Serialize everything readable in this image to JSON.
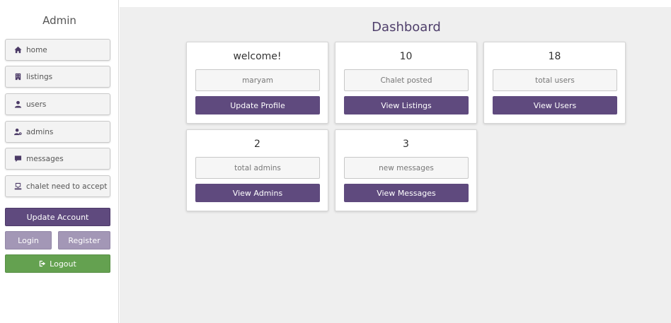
{
  "sidebar": {
    "title": "Admin",
    "items": [
      {
        "label": "home",
        "icon": "home-icon"
      },
      {
        "label": "listings",
        "icon": "building-icon"
      },
      {
        "label": "users",
        "icon": "user-icon"
      },
      {
        "label": "admins",
        "icon": "user-gear-icon"
      },
      {
        "label": "messages",
        "icon": "message-icon"
      },
      {
        "label": "chalet need to accept",
        "icon": "inbox-icon"
      }
    ],
    "update_account_label": "Update Account",
    "login_label": "Login",
    "register_label": "Register",
    "logout_label": "Logout"
  },
  "main": {
    "title": "Dashboard",
    "cards": [
      {
        "heading": "welcome!",
        "box": "maryam",
        "button": "Update Profile"
      },
      {
        "heading": "10",
        "box": "Chalet posted",
        "button": "View Listings"
      },
      {
        "heading": "18",
        "box": "total users",
        "button": "View Users"
      },
      {
        "heading": "2",
        "box": "total admins",
        "button": "View Admins"
      },
      {
        "heading": "3",
        "box": "new messages",
        "button": "View Messages"
      }
    ]
  },
  "colors": {
    "accent": "#5f4a7e",
    "muted_accent": "#a397b6",
    "logout": "#64a150",
    "background": "#efefef"
  }
}
